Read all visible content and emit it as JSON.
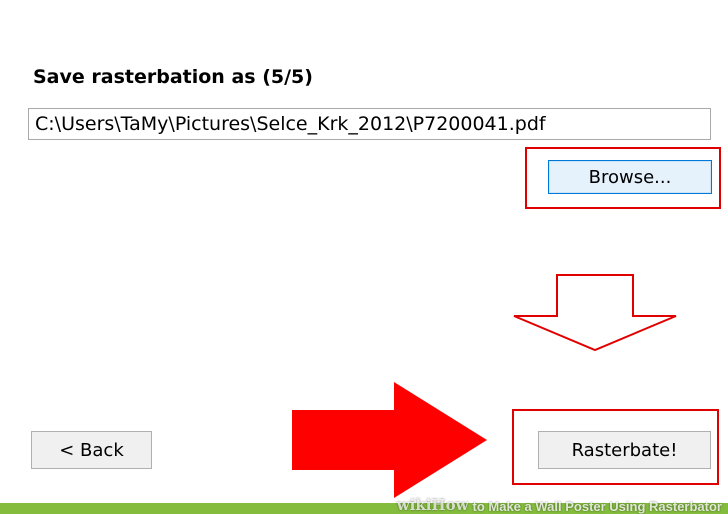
{
  "dialog": {
    "heading": "Save rasterbation as (5/5)",
    "file_path_value": "C:\\Users\\TaMy\\Pictures\\Selce_Krk_2012\\P7200041.pdf",
    "browse_label": "Browse...",
    "back_label": "< Back",
    "rasterbate_label": "Rasterbate!"
  },
  "annotations": {
    "highlight_color": "#e10000",
    "arrow_down": "outline-down-arrow",
    "arrow_right": "solid-right-arrow"
  },
  "watermark": {
    "brand_wiki": "wiki",
    "brand_how": "How",
    "title": "to Make a Wall Poster Using Rasterbator",
    "bar_color": "#84bc3e"
  }
}
